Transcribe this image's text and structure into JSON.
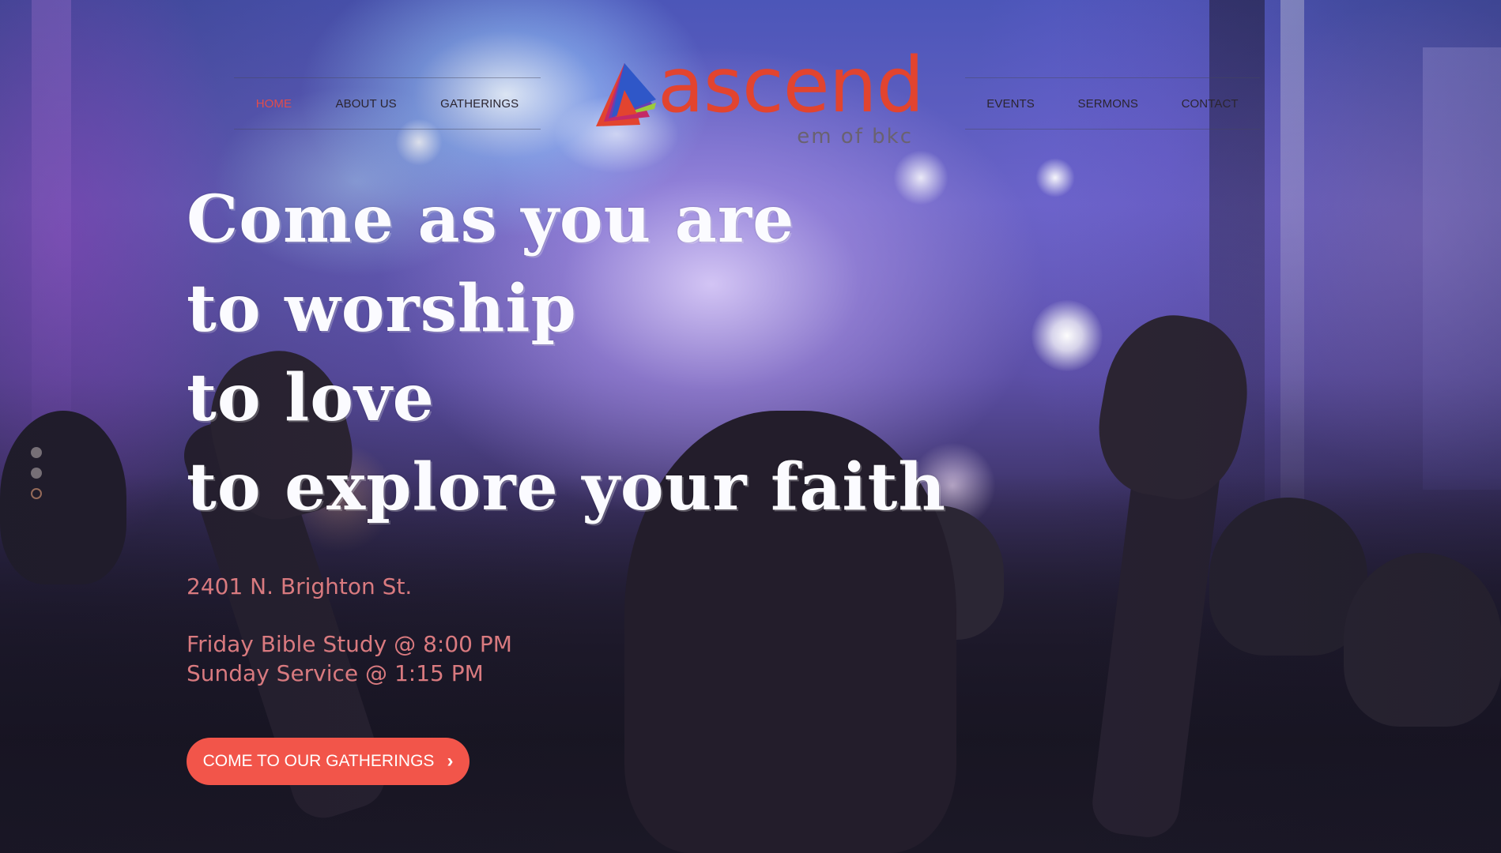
{
  "nav_left": [
    {
      "label": "HOME",
      "active": true
    },
    {
      "label": "ABOUT US",
      "active": false
    },
    {
      "label": "GATHERINGS",
      "active": false
    }
  ],
  "nav_right": [
    {
      "label": "EVENTS",
      "active": false
    },
    {
      "label": "SERMONS",
      "active": false
    },
    {
      "label": "CONTACT",
      "active": false
    }
  ],
  "logo": {
    "wordmark": "ascend",
    "subtitle": "em of bkc"
  },
  "hero": {
    "headline": [
      "Come as you are",
      "to worship",
      "to love",
      "to explore your faith"
    ],
    "address": "2401 N. Brighton St.",
    "schedule": [
      "Friday Bible Study @ 8:00 PM",
      "Sunday Service @ 1:15 PM"
    ],
    "cta_label": "COME TO OUR GATHERINGS"
  },
  "slider": {
    "slide_count": 3,
    "active_slide": 3
  },
  "colors": {
    "accent": "#f2554a",
    "nav_active": "#e14c4c",
    "logo_red": "#e2442f",
    "info_text": "#d97a7f"
  }
}
